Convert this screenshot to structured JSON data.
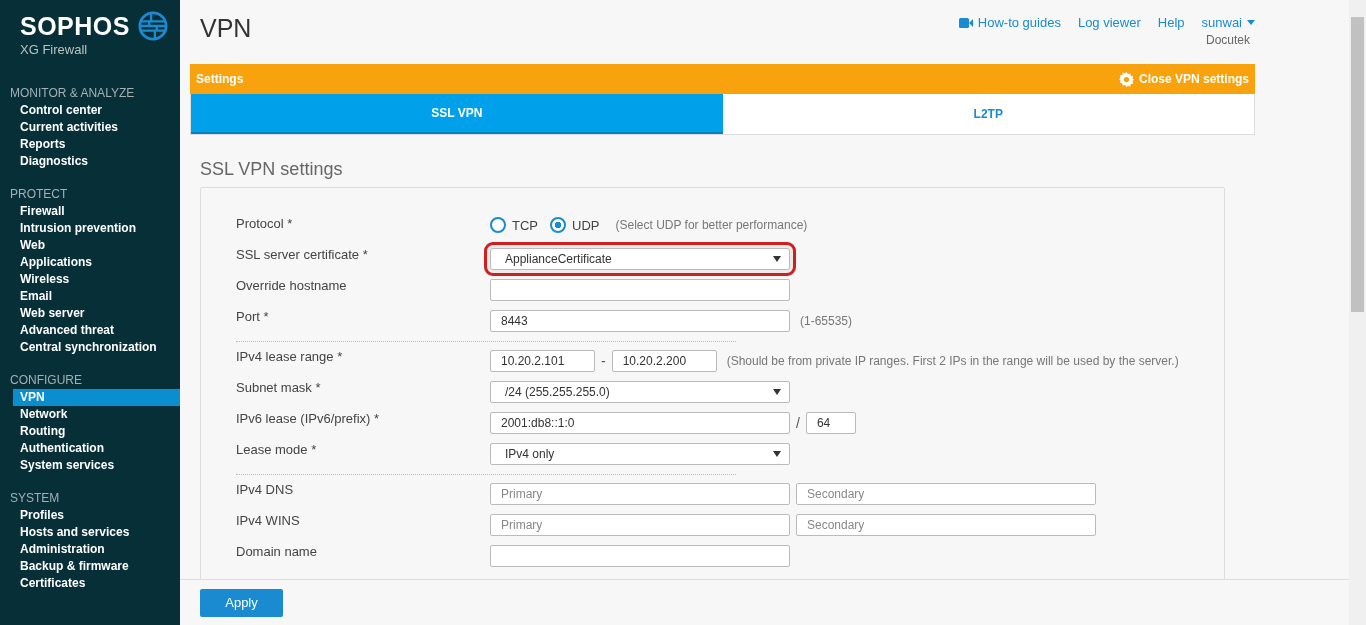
{
  "brand": {
    "name": "SOPHOS",
    "product": "XG Firewall"
  },
  "sidebar": {
    "sections": [
      {
        "heading": "MONITOR & ANALYZE",
        "items": [
          {
            "label": "Control center",
            "selected": false
          },
          {
            "label": "Current activities",
            "selected": false
          },
          {
            "label": "Reports",
            "selected": false
          },
          {
            "label": "Diagnostics",
            "selected": false
          }
        ]
      },
      {
        "heading": "PROTECT",
        "items": [
          {
            "label": "Firewall",
            "selected": false
          },
          {
            "label": "Intrusion prevention",
            "selected": false
          },
          {
            "label": "Web",
            "selected": false
          },
          {
            "label": "Applications",
            "selected": false
          },
          {
            "label": "Wireless",
            "selected": false
          },
          {
            "label": "Email",
            "selected": false
          },
          {
            "label": "Web server",
            "selected": false
          },
          {
            "label": "Advanced threat",
            "selected": false
          },
          {
            "label": "Central synchronization",
            "selected": false
          }
        ]
      },
      {
        "heading": "CONFIGURE",
        "items": [
          {
            "label": "VPN",
            "selected": true
          },
          {
            "label": "Network",
            "selected": false
          },
          {
            "label": "Routing",
            "selected": false
          },
          {
            "label": "Authentication",
            "selected": false
          },
          {
            "label": "System services",
            "selected": false
          }
        ]
      },
      {
        "heading": "SYSTEM",
        "items": [
          {
            "label": "Profiles",
            "selected": false
          },
          {
            "label": "Hosts and services",
            "selected": false
          },
          {
            "label": "Administration",
            "selected": false
          },
          {
            "label": "Backup & firmware",
            "selected": false
          },
          {
            "label": "Certificates",
            "selected": false
          }
        ]
      }
    ]
  },
  "page": {
    "title": "VPN"
  },
  "top_links": [
    {
      "label": "How-to guides",
      "kind": "video"
    },
    {
      "label": "Log viewer",
      "kind": "plain"
    },
    {
      "label": "Help",
      "kind": "plain"
    },
    {
      "label": "sunwai",
      "kind": "user"
    }
  ],
  "organization": "Docutek",
  "settings_bar": {
    "title": "Settings",
    "action": "Close VPN settings"
  },
  "tabs": [
    {
      "label": "SSL VPN",
      "selected": true
    },
    {
      "label": "L2TP",
      "selected": false
    }
  ],
  "form": {
    "title": "SSL VPN settings",
    "groups": [
      {
        "rows": [
          {
            "kind": "radio",
            "label": "Protocol *",
            "options": [
              {
                "label": "TCP",
                "selected": false
              },
              {
                "label": "UDP",
                "selected": true
              }
            ],
            "hint": "(Select UDP for better performance)"
          },
          {
            "kind": "select",
            "label": "SSL server certificate *",
            "value": "ApplianceCertificate",
            "highlighted": true
          },
          {
            "kind": "input",
            "label": "Override hostname"
          },
          {
            "kind": "input",
            "label": "Port *",
            "value": "8443",
            "hint": "(1-65535)"
          }
        ]
      },
      {
        "rows": [
          {
            "kind": "range",
            "label": "IPv4 lease range *",
            "from": "10.20.2.101",
            "separator": "-",
            "to": "10.20.2.200",
            "hint": "(Should be from private IP ranges. First 2 IPs in the range will be used by the server.)"
          },
          {
            "kind": "select",
            "label": "Subnet mask *",
            "value": "/24 (255.255.255.0)",
            "highlighted": false
          },
          {
            "kind": "prefix",
            "label": "IPv6 lease (IPv6/prefix) *",
            "value": "2001:db8::1:0",
            "separator": "/",
            "prefix": "64"
          },
          {
            "kind": "select",
            "label": "Lease mode *",
            "value": "IPv4 only",
            "highlighted": false
          }
        ]
      },
      {
        "rows": [
          {
            "kind": "pair",
            "label": "IPv4 DNS",
            "fields": [
              {
                "placeholder": "Primary"
              },
              {
                "placeholder": "Secondary"
              }
            ]
          },
          {
            "kind": "pair",
            "label": "IPv4 WINS",
            "fields": [
              {
                "placeholder": "Primary"
              },
              {
                "placeholder": "Secondary"
              }
            ]
          },
          {
            "kind": "input",
            "label": "Domain name"
          }
        ]
      }
    ]
  },
  "apply_button": "Apply"
}
